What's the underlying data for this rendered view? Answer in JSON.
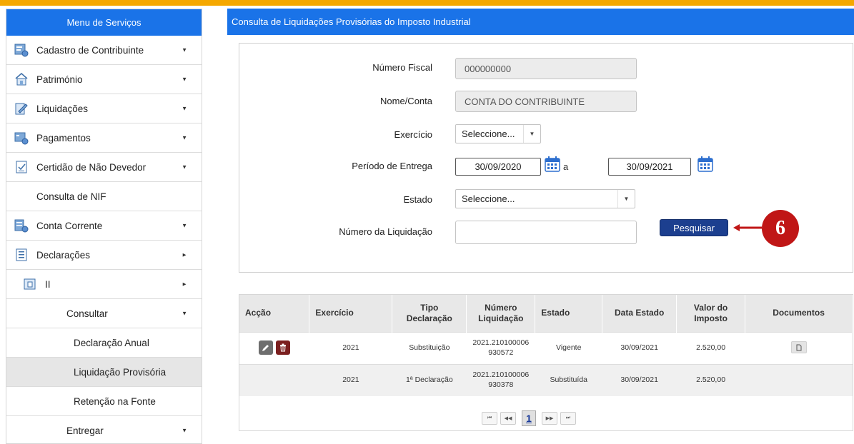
{
  "sidebar": {
    "title": "Menu de Serviços",
    "items": [
      {
        "label": "Cadastro de Contribuinte"
      },
      {
        "label": "Património"
      },
      {
        "label": "Liquidações"
      },
      {
        "label": "Pagamentos"
      },
      {
        "label": "Certidão de Não Devedor"
      },
      {
        "label": "Consulta de NIF"
      },
      {
        "label": "Conta Corrente"
      },
      {
        "label": "Declarações"
      },
      {
        "label": "II"
      },
      {
        "label": "Consultar"
      },
      {
        "label": "Declaração Anual"
      },
      {
        "label": "Liquidação Provisória"
      },
      {
        "label": "Retenção na Fonte"
      },
      {
        "label": "Entregar"
      }
    ]
  },
  "main": {
    "title": "Consulta de Liquidações Provisórias do Imposto Industrial"
  },
  "form": {
    "numero_fiscal_label": "Número Fiscal",
    "numero_fiscal_value": "000000000",
    "nome_conta_label": "Nome/Conta",
    "nome_conta_value": "CONTA DO CONTRIBUINTE",
    "exercicio_label": "Exercício",
    "exercicio_value": "Seleccione...",
    "periodo_label": "Período de Entrega",
    "periodo_from": "30/09/2020",
    "periodo_sep": "a",
    "periodo_to": "30/09/2021",
    "estado_label": "Estado",
    "estado_value": "Seleccione...",
    "numero_liq_label": "Número da Liquidação",
    "numero_liq_value": "",
    "search_label": "Pesquisar"
  },
  "table": {
    "headers": [
      "Acção",
      "Exercício",
      "Tipo Declaração",
      "Número Liquidação",
      "Estado",
      "Data Estado",
      "Valor do Imposto",
      "Documentos"
    ],
    "rows": [
      {
        "exercicio": "2021",
        "tipo": "Substituição",
        "numero": "2021.210100006 930572",
        "estado": "Vigente",
        "data": "30/09/2021",
        "valor": "2.520,00"
      },
      {
        "exercicio": "2021",
        "tipo": "1ª Declaração",
        "numero": "2021.210100006 930378",
        "estado": "Substituída",
        "data": "30/09/2021",
        "valor": "2.520,00"
      }
    ]
  },
  "pagination": {
    "current_page": "1",
    "first": "⏮",
    "prev": "◀◀",
    "next": "▶▶",
    "last": "⏭"
  },
  "annotation": {
    "step": "6"
  },
  "colors": {
    "header_blue": "#1a73e8",
    "top_bar": "#f5a800",
    "search_button": "#1c3f8f",
    "callout_red": "#c01616",
    "delete_red": "#7b1f1f"
  }
}
